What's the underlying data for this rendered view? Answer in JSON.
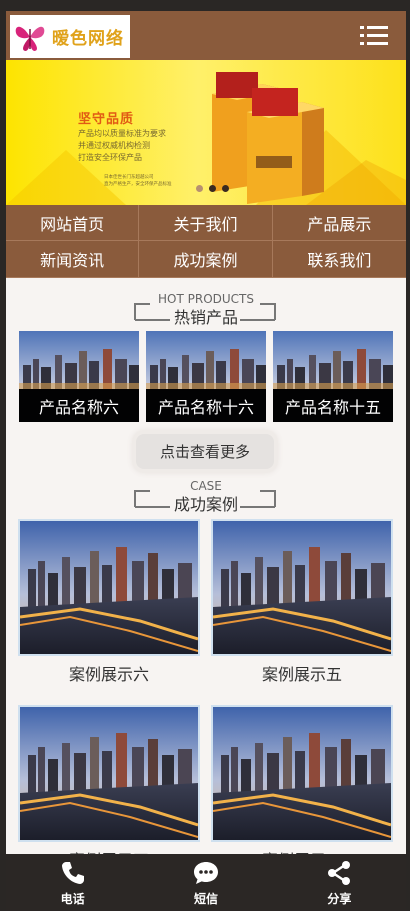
{
  "header": {
    "logo_text": "暧色网络",
    "menu_icon": "menu-icon"
  },
  "banner": {
    "title": "坚守品质",
    "lines": [
      "产品均以质量标准为要求",
      "并通过权威机构检测",
      "打造安全环保产品"
    ],
    "small_lines": [
      "日本佳世长门东超越公司",
      "直为严格生产，安全环保产品标准"
    ],
    "slide_count": 3,
    "active_slide": 1
  },
  "nav": {
    "items": [
      "网站首页",
      "关于我们",
      "产品展示",
      "新闻资讯",
      "成功案例",
      "联系我们"
    ]
  },
  "hot_products": {
    "title_en": "HOT PRODUCTS",
    "title_cn": "热销产品",
    "items": [
      {
        "name": "产品名称六"
      },
      {
        "name": "产品名称十六"
      },
      {
        "name": "产品名称十五"
      }
    ],
    "more_label": "点击查看更多"
  },
  "cases": {
    "title_en": "CASE",
    "title_cn": "成功案例",
    "items": [
      {
        "name": "案例展示六"
      },
      {
        "name": "案例展示五"
      },
      {
        "name": "案例展示四"
      },
      {
        "name": "案例展示三"
      }
    ]
  },
  "footer": {
    "items": [
      {
        "label": "电话",
        "icon": "phone-icon"
      },
      {
        "label": "短信",
        "icon": "message-icon"
      },
      {
        "label": "分享",
        "icon": "share-icon"
      }
    ]
  },
  "colors": {
    "brand_brown": "#8a5b3c",
    "banner_yellow": "#fde400",
    "footer_dark": "#2b2725"
  }
}
